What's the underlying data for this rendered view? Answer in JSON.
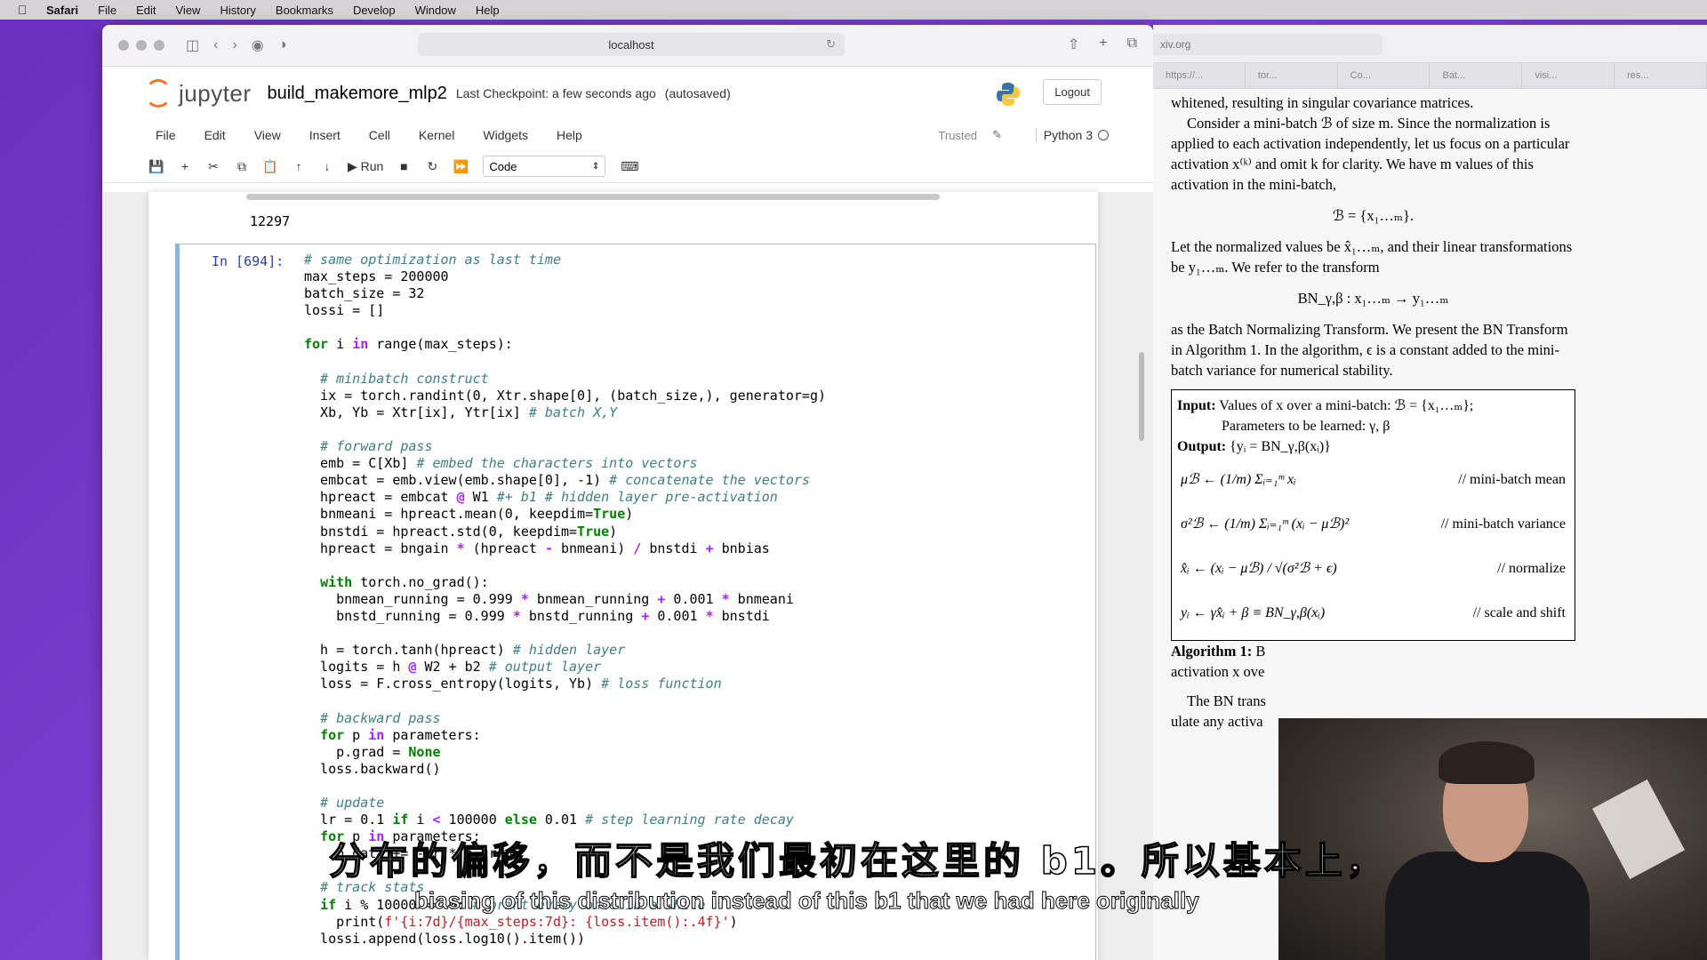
{
  "menubar": {
    "app": "Safari",
    "items": [
      "File",
      "Edit",
      "View",
      "History",
      "Bookmarks",
      "Develop",
      "Window",
      "Help"
    ]
  },
  "browser": {
    "url": "localhost"
  },
  "jupyter": {
    "logo_text": "jupyter",
    "notebook_name": "build_makemore_mlp2",
    "checkpoint": "Last Checkpoint: a few seconds ago",
    "autosaved": "(autosaved)",
    "logout": "Logout",
    "menu": [
      "File",
      "Edit",
      "View",
      "Insert",
      "Cell",
      "Kernel",
      "Widgets",
      "Help"
    ],
    "trusted": "Trusted",
    "kernel": "Python 3",
    "toolbar": {
      "run_label": "Run",
      "cell_type": "Code"
    }
  },
  "notebook": {
    "prev_output": "12297",
    "cell_prompt": "In [694]:"
  },
  "paper": {
    "url_fragment": "xiv.org",
    "tabs": [
      "https://...",
      "tor...",
      "Co...",
      "Bat...",
      "visi...",
      "res..."
    ],
    "p1": "whitened, resulting in singular covariance matrices.",
    "p2": "Consider a mini-batch ℬ of size m. Since the normalization is applied to each activation independently, let us focus on a particular activation x⁽ᵏ⁾ and omit k for clarity. We have m values of this activation in the mini-batch,",
    "eq1": "ℬ = {x₁…ₘ}.",
    "p3": "Let the normalized values be x̂₁…ₘ, and their linear transformations be y₁…ₘ. We refer to the transform",
    "eq2": "BN_γ,β : x₁…ₘ → y₁…ₘ",
    "p4": "as the Batch Normalizing Transform. We present the BN Transform in Algorithm 1. In the algorithm, ϵ is a constant added to the mini-batch variance for numerical stability.",
    "algo_input_label": "Input:",
    "algo_input": "Values of x over a mini-batch: ℬ = {x₁…ₘ};",
    "algo_params": "Parameters to be learned: γ, β",
    "algo_output_label": "Output:",
    "algo_output": "{yᵢ = BN_γ,β(xᵢ)}",
    "steps": [
      {
        "formula": "μℬ ← (1/m) Σᵢ₌₁ᵐ xᵢ",
        "comment": "// mini-batch mean"
      },
      {
        "formula": "σ²ℬ ← (1/m) Σᵢ₌₁ᵐ (xᵢ − μℬ)²",
        "comment": "// mini-batch variance"
      },
      {
        "formula": "x̂ᵢ ← (xᵢ − μℬ) / √(σ²ℬ + ϵ)",
        "comment": "// normalize"
      },
      {
        "formula": "yᵢ ← γx̂ᵢ + β ≡ BN_γ,β(xᵢ)",
        "comment": "// scale and shift"
      }
    ],
    "caption_label": "Algorithm 1:",
    "caption_rest": "B",
    "caption_line2": "activation x ove",
    "p5a": "The BN trans",
    "p5b": "ulate any activa"
  },
  "subtitles": {
    "zh": "分布的偏移，而不是我们最初在这里的 b1。所以基本上，",
    "en": "biasing of this distribution instead of this b1 that we had here originally"
  }
}
